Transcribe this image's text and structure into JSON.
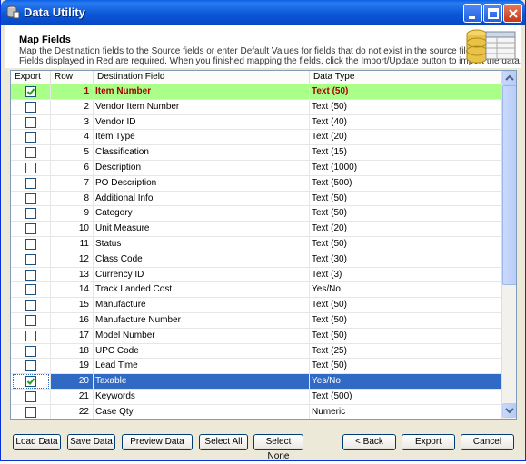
{
  "window": {
    "title": "Data Utility"
  },
  "header": {
    "title": "Map Fields",
    "line1": "Map the Destination fields to the Source fields or enter Default Values for fields that do not exist in the source file.",
    "line2": "Fields displayed in Red are required.  When you finished mapping the fields, click the Import/Update button to import the data."
  },
  "grid": {
    "columns": {
      "export": "Export",
      "row": "Row",
      "field": "Destination Field",
      "type": "Data Type"
    },
    "rows": [
      {
        "checked": true,
        "row": "1",
        "field": "Item Number",
        "type": "Text (50)",
        "required": true
      },
      {
        "checked": false,
        "row": "2",
        "field": "Vendor Item Number",
        "type": "Text (50)"
      },
      {
        "checked": false,
        "row": "3",
        "field": "Vendor ID",
        "type": "Text (40)"
      },
      {
        "checked": false,
        "row": "4",
        "field": "Item Type",
        "type": "Text (20)"
      },
      {
        "checked": false,
        "row": "5",
        "field": "Classification",
        "type": "Text (15)"
      },
      {
        "checked": false,
        "row": "6",
        "field": "Description",
        "type": "Text (1000)"
      },
      {
        "checked": false,
        "row": "7",
        "field": "PO Description",
        "type": "Text (500)"
      },
      {
        "checked": false,
        "row": "8",
        "field": "Additional Info",
        "type": "Text (50)"
      },
      {
        "checked": false,
        "row": "9",
        "field": "Category",
        "type": "Text (50)"
      },
      {
        "checked": false,
        "row": "10",
        "field": "Unit Measure",
        "type": "Text (20)"
      },
      {
        "checked": false,
        "row": "11",
        "field": "Status",
        "type": "Text (50)"
      },
      {
        "checked": false,
        "row": "12",
        "field": "Class Code",
        "type": "Text (30)"
      },
      {
        "checked": false,
        "row": "13",
        "field": "Currency ID",
        "type": "Text (3)"
      },
      {
        "checked": false,
        "row": "14",
        "field": "Track Landed Cost",
        "type": "Yes/No"
      },
      {
        "checked": false,
        "row": "15",
        "field": "Manufacture",
        "type": "Text (50)"
      },
      {
        "checked": false,
        "row": "16",
        "field": "Manufacture Number",
        "type": "Text (50)"
      },
      {
        "checked": false,
        "row": "17",
        "field": "Model Number",
        "type": "Text (50)"
      },
      {
        "checked": false,
        "row": "18",
        "field": "UPC Code",
        "type": "Text (25)"
      },
      {
        "checked": false,
        "row": "19",
        "field": "Lead Time",
        "type": "Text (50)"
      },
      {
        "checked": true,
        "row": "20",
        "field": "Taxable",
        "type": "Yes/No",
        "selected": true
      },
      {
        "checked": false,
        "row": "21",
        "field": "Keywords",
        "type": "Text (500)"
      },
      {
        "checked": false,
        "row": "22",
        "field": "Case Qty",
        "type": "Numeric"
      }
    ]
  },
  "buttons": {
    "load": "Load Data",
    "save": "Save Data",
    "preview": "Preview Data",
    "select_all": "Select All",
    "select_none": "Select None",
    "back": "< Back",
    "export": "Export",
    "cancel": "Cancel"
  },
  "colors": {
    "title_bar": "#0a58d8",
    "required_row": "#aaff88",
    "required_text": "#a50000",
    "selection": "#316ac5"
  }
}
